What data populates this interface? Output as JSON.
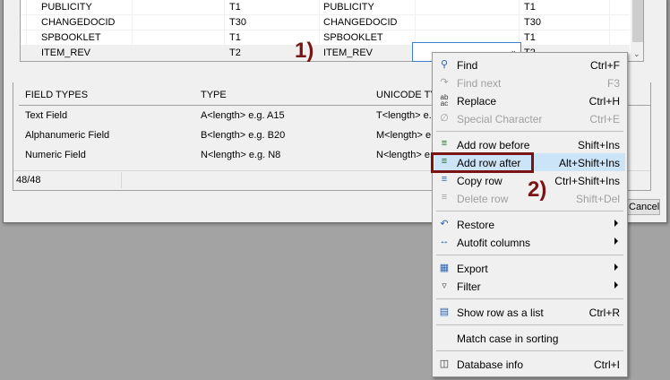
{
  "grid": {
    "rows": [
      {
        "name": "PUBLICITY",
        "type": "T1",
        "name2": "PUBLICITY",
        "type2": "T1"
      },
      {
        "name": "CHANGEDOCID",
        "type": "T30",
        "name2": "CHANGEDOCID",
        "type2": "T30"
      },
      {
        "name": "SPBOOKLET",
        "type": "T1",
        "name2": "SPBOOKLET",
        "type2": "T1"
      },
      {
        "name": "ITEM_REV",
        "type": "T2",
        "name2": "ITEM_REV",
        "type2": "T2"
      }
    ]
  },
  "field_types": {
    "headers": [
      "FIELD TYPES",
      "TYPE",
      "UNICODE TYPE"
    ],
    "rows": [
      {
        "name": "Text Field",
        "type": "A<length> e.g. A15",
        "unicode": "T<length> e.g. T15"
      },
      {
        "name": "Alphanumeric Field",
        "type": "B<length> e.g. B20",
        "unicode": "M<length> e.g. M20"
      },
      {
        "name": "Numeric Field",
        "type": "N<length> e.g. N8",
        "unicode": "N<length> e.g. N8"
      }
    ]
  },
  "status": {
    "count": "48/48"
  },
  "buttons": {
    "cancel": "Cancel"
  },
  "menu": {
    "items": [
      {
        "label": "Find",
        "shortcut": "Ctrl+F",
        "icon": "search-icon"
      },
      {
        "label": "Find next",
        "shortcut": "F3",
        "icon": "find-next-icon"
      },
      {
        "label": "Replace",
        "shortcut": "Ctrl+H",
        "icon": "replace-icon"
      },
      {
        "label": "Special Character",
        "shortcut": "Ctrl+E",
        "icon": "special-character-icon"
      },
      {
        "label": "Add row before",
        "shortcut": "Shift+Ins",
        "icon": "add-row-before-icon"
      },
      {
        "label": "Add row after",
        "shortcut": "Alt+Shift+Ins",
        "icon": "add-row-after-icon"
      },
      {
        "label": "Copy row",
        "shortcut": "Ctrl+Shift+Ins",
        "icon": "copy-row-icon"
      },
      {
        "label": "Delete row",
        "shortcut": "Shift+Del",
        "icon": "delete-row-icon"
      },
      {
        "label": "Restore",
        "icon": "restore-icon"
      },
      {
        "label": "Autofit columns",
        "icon": "autofit-columns-icon"
      },
      {
        "label": "Export",
        "icon": "export-icon"
      },
      {
        "label": "Filter",
        "icon": "filter-icon"
      },
      {
        "label": "Show row as a list",
        "shortcut": "Ctrl+R",
        "icon": "show-row-list-icon"
      },
      {
        "label": "Match case in sorting"
      },
      {
        "label": "Database info",
        "shortcut": "Ctrl+I",
        "icon": "database-info-icon"
      }
    ]
  },
  "annotations": {
    "step1": "1)",
    "step2": "2)"
  },
  "colors": {
    "annotation": "#7a1414",
    "highlight": "#cce4f7"
  }
}
